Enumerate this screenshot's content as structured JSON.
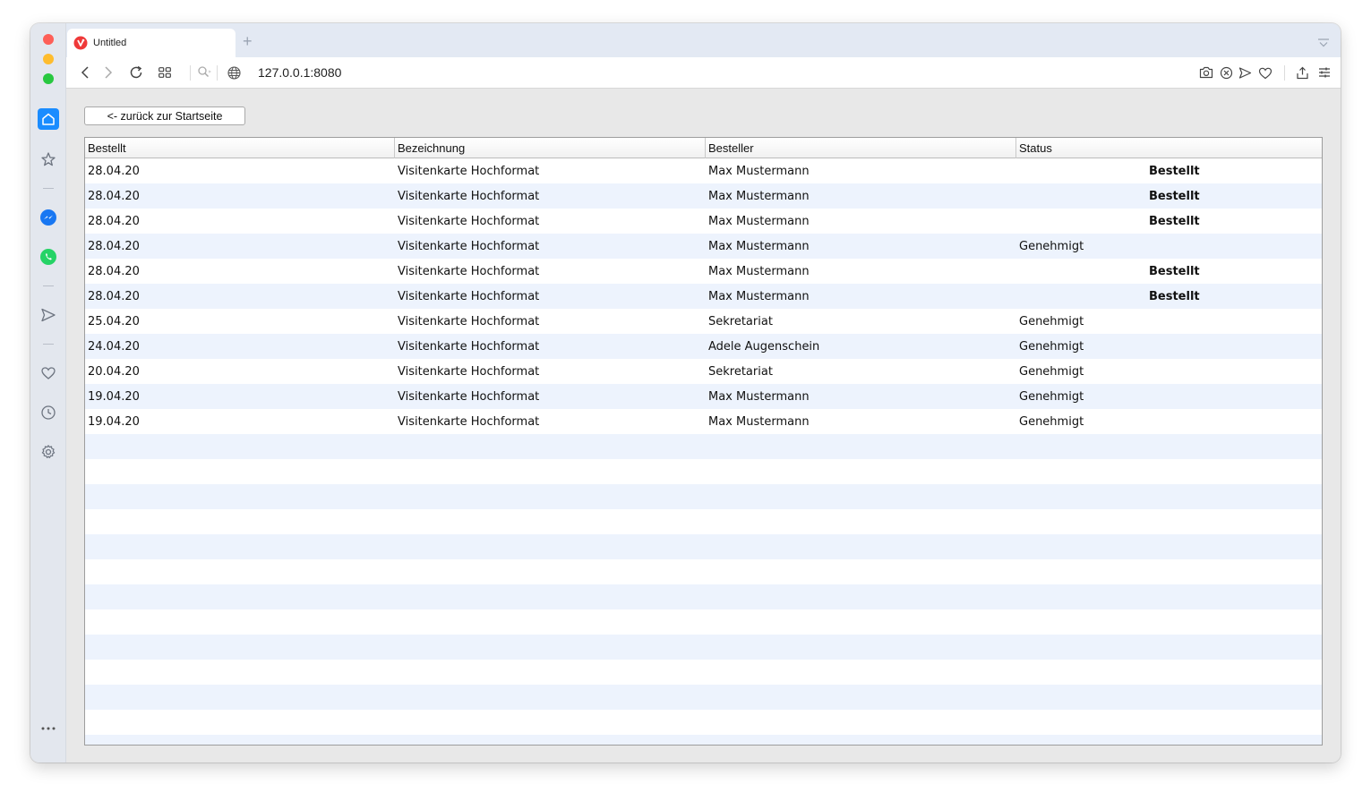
{
  "browser": {
    "tab_title": "Untitled",
    "new_tab": "+",
    "url": "127.0.0.1:8080"
  },
  "page": {
    "back_button": "<- zurück zur Startseite"
  },
  "table": {
    "columns": [
      "Bestellt",
      "Bezeichnung",
      "Besteller",
      "Status"
    ],
    "rows": [
      {
        "date": "28.04.20",
        "name": "Visitenkarte Hochformat",
        "orderer": "Max Mustermann",
        "status_genehmigt": "",
        "status_bestellt": "Bestellt"
      },
      {
        "date": "28.04.20",
        "name": "Visitenkarte Hochformat",
        "orderer": "Max Mustermann",
        "status_genehmigt": "",
        "status_bestellt": "Bestellt"
      },
      {
        "date": "28.04.20",
        "name": "Visitenkarte Hochformat",
        "orderer": "Max Mustermann",
        "status_genehmigt": "",
        "status_bestellt": "Bestellt"
      },
      {
        "date": "28.04.20",
        "name": "Visitenkarte Hochformat",
        "orderer": "Max Mustermann",
        "status_genehmigt": "Genehmigt",
        "status_bestellt": ""
      },
      {
        "date": "28.04.20",
        "name": "Visitenkarte Hochformat",
        "orderer": "Max Mustermann",
        "status_genehmigt": "",
        "status_bestellt": "Bestellt"
      },
      {
        "date": "28.04.20",
        "name": "Visitenkarte Hochformat",
        "orderer": "Max Mustermann",
        "status_genehmigt": "",
        "status_bestellt": "Bestellt"
      },
      {
        "date": "25.04.20",
        "name": "Visitenkarte Hochformat",
        "orderer": "Sekretariat",
        "status_genehmigt": "Genehmigt",
        "status_bestellt": ""
      },
      {
        "date": "24.04.20",
        "name": "Visitenkarte Hochformat",
        "orderer": "Adele Augenschein",
        "status_genehmigt": "Genehmigt",
        "status_bestellt": ""
      },
      {
        "date": "20.04.20",
        "name": "Visitenkarte Hochformat",
        "orderer": "Sekretariat",
        "status_genehmigt": "Genehmigt",
        "status_bestellt": ""
      },
      {
        "date": "19.04.20",
        "name": "Visitenkarte Hochformat",
        "orderer": "Max Mustermann",
        "status_genehmigt": "Genehmigt",
        "status_bestellt": ""
      },
      {
        "date": "19.04.20",
        "name": "Visitenkarte Hochformat",
        "orderer": "Max Mustermann",
        "status_genehmigt": "Genehmigt",
        "status_bestellt": ""
      }
    ]
  },
  "colors": {
    "accent": "#1a8cff",
    "row_alt": "#edf3fd",
    "messenger": "#1877f2",
    "whatsapp": "#25d366"
  }
}
